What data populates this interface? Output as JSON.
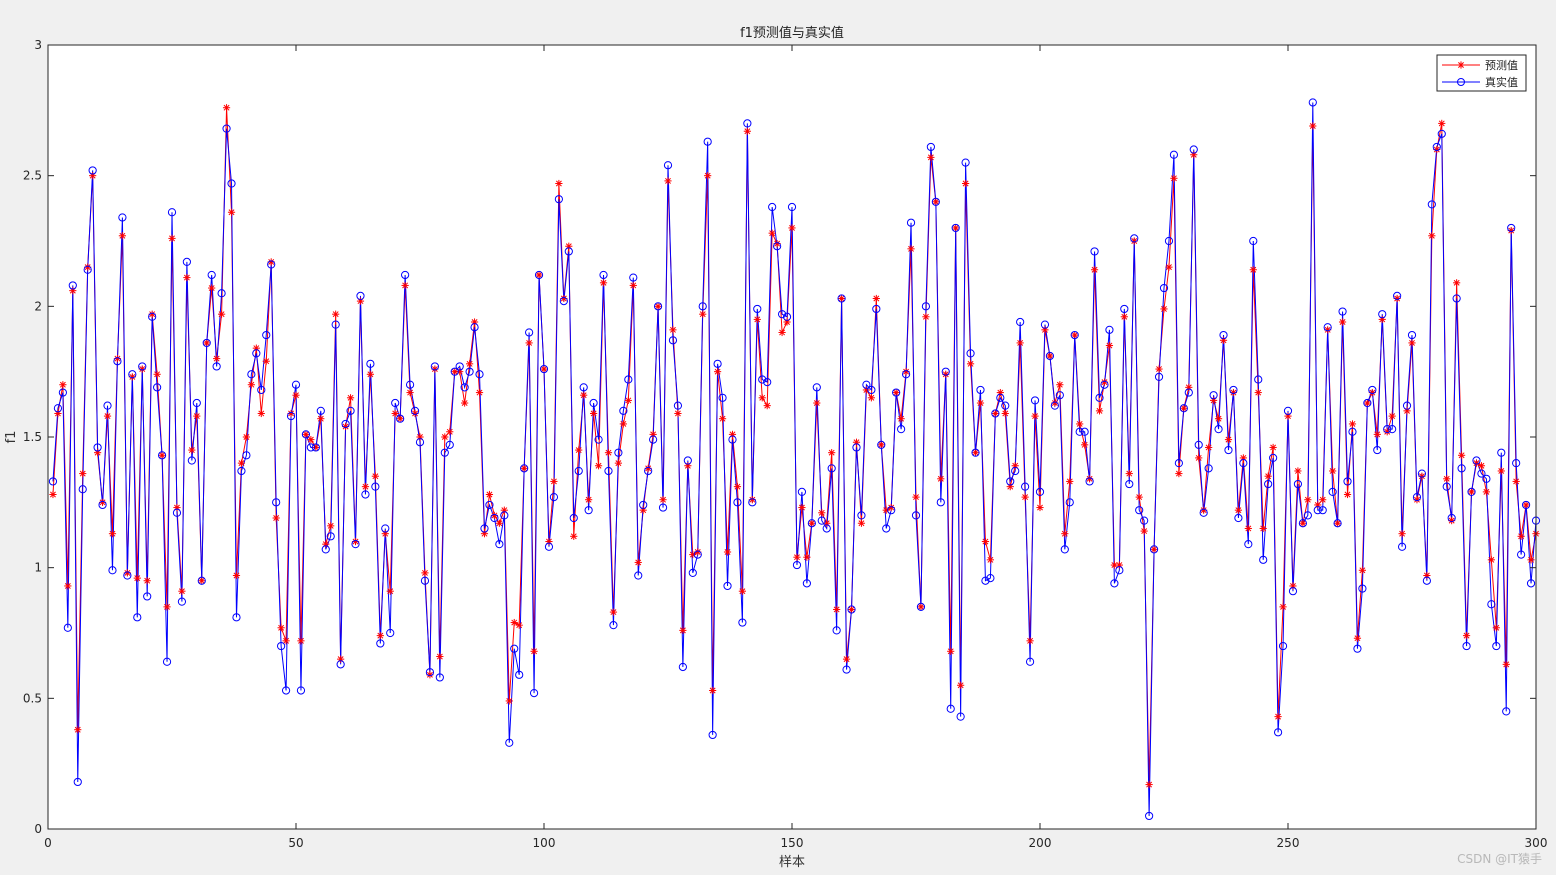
{
  "watermark": "CSDN @IT猿手",
  "chart_data": {
    "type": "line",
    "title": "f1预测值与真实值",
    "xlabel": "样本",
    "ylabel": "f1",
    "xlim": [
      0,
      300
    ],
    "ylim": [
      0,
      3
    ],
    "xticks": [
      0,
      50,
      100,
      150,
      200,
      250,
      300
    ],
    "yticks": [
      0,
      0.5,
      1,
      1.5,
      2,
      2.5,
      3
    ],
    "xtick_labels": [
      "0",
      "50",
      "100",
      "150",
      "200",
      "250",
      "300"
    ],
    "ytick_labels": [
      "0",
      "0.5",
      "1",
      "1.5",
      "2",
      "2.5",
      "3"
    ],
    "grid": false,
    "legend_position": "top-right",
    "series": [
      {
        "name": "预测值",
        "color": "#ff0000",
        "marker": "asterisk",
        "values": [
          1.28,
          1.59,
          1.7,
          0.93,
          2.06,
          0.38,
          1.36,
          2.15,
          2.5,
          1.44,
          1.25,
          1.58,
          1.13,
          1.8,
          2.27,
          0.98,
          1.73,
          0.96,
          1.76,
          0.95,
          1.97,
          1.74,
          1.43,
          0.85,
          2.26,
          1.23,
          0.91,
          2.11,
          1.45,
          1.58,
          0.95,
          1.86,
          2.07,
          1.8,
          1.97,
          2.76,
          2.36,
          0.97,
          1.4,
          1.5,
          1.7,
          1.84,
          1.59,
          1.79,
          2.17,
          1.19,
          0.77,
          0.72,
          1.59,
          1.66,
          0.72,
          1.51,
          1.49,
          1.46,
          1.57,
          1.09,
          1.16,
          1.97,
          0.65,
          1.54,
          1.65,
          1.1,
          2.02,
          1.31,
          1.74,
          1.35,
          0.74,
          1.13,
          0.91,
          1.59,
          1.57,
          2.08,
          1.67,
          1.59,
          1.5,
          0.98,
          0.59,
          1.76,
          0.66,
          1.5,
          1.52,
          1.75,
          1.75,
          1.63,
          1.78,
          1.94,
          1.67,
          1.13,
          1.28,
          1.2,
          1.17,
          1.22,
          0.49,
          0.79,
          0.78,
          1.38,
          1.86,
          0.68,
          2.12,
          1.76,
          1.1,
          1.33,
          2.47,
          2.03,
          2.23,
          1.12,
          1.45,
          1.66,
          1.26,
          1.59,
          1.39,
          2.09,
          1.44,
          0.83,
          1.4,
          1.55,
          1.64,
          2.08,
          1.02,
          1.22,
          1.38,
          1.51,
          2.0,
          1.26,
          2.48,
          1.91,
          1.59,
          0.76,
          1.39,
          1.05,
          1.06,
          1.97,
          2.5,
          0.53,
          1.75,
          1.57,
          1.06,
          1.51,
          1.31,
          0.91,
          2.67,
          1.26,
          1.95,
          1.65,
          1.62,
          2.28,
          2.24,
          1.9,
          1.94,
          2.3,
          1.04,
          1.23,
          1.04,
          1.17,
          1.63,
          1.21,
          1.17,
          1.44,
          0.84,
          2.03,
          0.65,
          0.84,
          1.48,
          1.17,
          1.68,
          1.65,
          2.03,
          1.47,
          1.22,
          1.23,
          1.67,
          1.57,
          1.75,
          2.22,
          1.27,
          0.85,
          1.96,
          2.57,
          2.4,
          1.34,
          1.74,
          0.68,
          2.3,
          0.55,
          2.47,
          1.78,
          1.44,
          1.63,
          1.1,
          1.03,
          1.59,
          1.67,
          1.59,
          1.31,
          1.39,
          1.86,
          1.27,
          0.72,
          1.58,
          1.23,
          1.91,
          1.81,
          1.63,
          1.7,
          1.13,
          1.33,
          1.89,
          1.55,
          1.47,
          1.34,
          2.14,
          1.6,
          1.71,
          1.85,
          1.01,
          1.01,
          1.96,
          1.36,
          2.25,
          1.27,
          1.14,
          0.17,
          1.07,
          1.76,
          1.99,
          2.15,
          2.49,
          1.36,
          1.61,
          1.69,
          2.58,
          1.42,
          1.22,
          1.46,
          1.64,
          1.57,
          1.87,
          1.49,
          1.67,
          1.22,
          1.42,
          1.15,
          2.14,
          1.67,
          1.15,
          1.35,
          1.46,
          0.43,
          0.85,
          1.58,
          0.93,
          1.37,
          1.17,
          1.26,
          2.69,
          1.24,
          1.26,
          1.91,
          1.37,
          1.17,
          1.94,
          1.28,
          1.55,
          0.73,
          0.99,
          1.63,
          1.67,
          1.51,
          1.95,
          1.52,
          1.58,
          2.03,
          1.13,
          1.6,
          1.86,
          1.26,
          1.35,
          0.97,
          2.27,
          2.6,
          2.7,
          1.34,
          1.18,
          2.09,
          1.43,
          0.74,
          1.29,
          1.4,
          1.39,
          1.29,
          1.03,
          0.77,
          1.37,
          0.63,
          2.29,
          1.33,
          1.12,
          1.24,
          1.03,
          1.13
        ]
      },
      {
        "name": "真实值",
        "color": "#0000ff",
        "marker": "circle",
        "values": [
          1.33,
          1.61,
          1.67,
          0.77,
          2.08,
          0.18,
          1.3,
          2.14,
          2.52,
          1.46,
          1.24,
          1.62,
          0.99,
          1.79,
          2.34,
          0.97,
          1.74,
          0.81,
          1.77,
          0.89,
          1.96,
          1.69,
          1.43,
          0.64,
          2.36,
          1.21,
          0.87,
          2.17,
          1.41,
          1.63,
          0.95,
          1.86,
          2.12,
          1.77,
          2.05,
          2.68,
          2.47,
          0.81,
          1.37,
          1.43,
          1.74,
          1.82,
          1.68,
          1.89,
          2.16,
          1.25,
          0.7,
          0.53,
          1.58,
          1.7,
          0.53,
          1.51,
          1.46,
          1.46,
          1.6,
          1.07,
          1.12,
          1.93,
          0.63,
          1.55,
          1.6,
          1.09,
          2.04,
          1.28,
          1.78,
          1.31,
          0.71,
          1.15,
          0.75,
          1.63,
          1.57,
          2.12,
          1.7,
          1.6,
          1.48,
          0.95,
          0.6,
          1.77,
          0.58,
          1.44,
          1.47,
          1.75,
          1.77,
          1.69,
          1.75,
          1.92,
          1.74,
          1.15,
          1.24,
          1.19,
          1.09,
          1.2,
          0.33,
          0.69,
          0.59,
          1.38,
          1.9,
          0.52,
          2.12,
          1.76,
          1.08,
          1.27,
          2.41,
          2.02,
          2.21,
          1.19,
          1.37,
          1.69,
          1.22,
          1.63,
          1.49,
          2.12,
          1.37,
          0.78,
          1.44,
          1.6,
          1.72,
          2.11,
          0.97,
          1.24,
          1.37,
          1.49,
          2.0,
          1.23,
          2.54,
          1.87,
          1.62,
          0.62,
          1.41,
          0.98,
          1.05,
          2.0,
          2.63,
          0.36,
          1.78,
          1.65,
          0.93,
          1.49,
          1.25,
          0.79,
          2.7,
          1.25,
          1.99,
          1.72,
          1.71,
          2.38,
          2.23,
          1.97,
          1.96,
          2.38,
          1.01,
          1.29,
          0.94,
          1.17,
          1.69,
          1.18,
          1.15,
          1.38,
          0.76,
          2.03,
          0.61,
          0.84,
          1.46,
          1.2,
          1.7,
          1.68,
          1.99,
          1.47,
          1.15,
          1.22,
          1.67,
          1.53,
          1.74,
          2.32,
          1.2,
          0.85,
          2.0,
          2.61,
          2.4,
          1.25,
          1.75,
          0.46,
          2.3,
          0.43,
          2.55,
          1.82,
          1.44,
          1.68,
          0.95,
          0.96,
          1.59,
          1.65,
          1.62,
          1.33,
          1.37,
          1.94,
          1.31,
          0.64,
          1.64,
          1.29,
          1.93,
          1.81,
          1.62,
          1.66,
          1.07,
          1.25,
          1.89,
          1.52,
          1.52,
          1.33,
          2.21,
          1.65,
          1.7,
          1.91,
          0.94,
          0.99,
          1.99,
          1.32,
          2.26,
          1.22,
          1.18,
          0.05,
          1.07,
          1.73,
          2.07,
          2.25,
          2.58,
          1.4,
          1.61,
          1.67,
          2.6,
          1.47,
          1.21,
          1.38,
          1.66,
          1.53,
          1.89,
          1.45,
          1.68,
          1.19,
          1.4,
          1.09,
          2.25,
          1.72,
          1.03,
          1.32,
          1.42,
          0.37,
          0.7,
          1.6,
          0.91,
          1.32,
          1.17,
          1.2,
          2.78,
          1.22,
          1.22,
          1.92,
          1.29,
          1.17,
          1.98,
          1.33,
          1.52,
          0.69,
          0.92,
          1.63,
          1.68,
          1.45,
          1.97,
          1.53,
          1.53,
          2.04,
          1.08,
          1.62,
          1.89,
          1.27,
          1.36,
          0.95,
          2.39,
          2.61,
          2.66,
          1.31,
          1.19,
          2.03,
          1.38,
          0.7,
          1.29,
          1.41,
          1.36,
          1.34,
          0.86,
          0.7,
          1.44,
          0.45,
          2.3,
          1.4,
          1.05,
          1.24,
          0.94,
          1.18
        ]
      }
    ]
  }
}
